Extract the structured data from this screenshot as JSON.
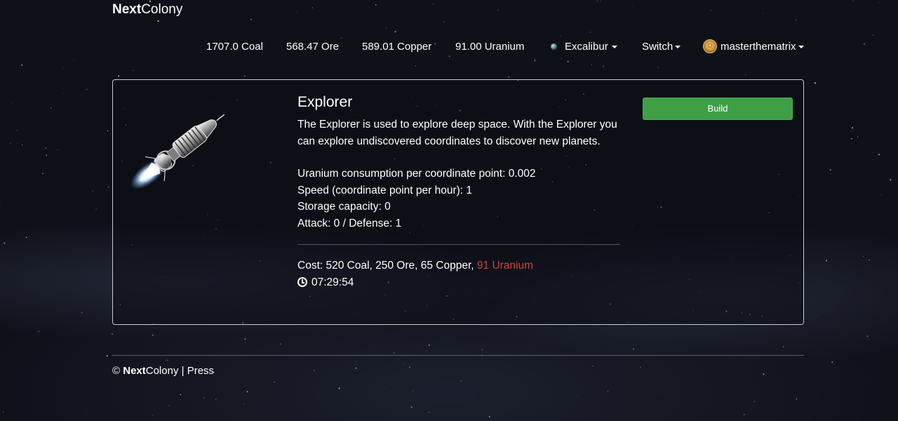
{
  "brand": {
    "bold": "Next",
    "regular": "Colony"
  },
  "resources": {
    "coal": "1707.0 Coal",
    "ore": "568.47 Ore",
    "copper": "589.01 Copper",
    "uranium": "91.00 Uranium"
  },
  "nav": {
    "planet": "Excalibur",
    "switch": "Switch",
    "user": "masterthematrix"
  },
  "ship": {
    "name": "Explorer",
    "description": "The Explorer is used to explore deep space. With the Explorer you can explore undiscovered coordinates to discover new planets.",
    "stats": [
      "Uranium consumption per coordinate point: 0.002",
      "Speed (coordinate point per hour): 1",
      "Storage capacity: 0",
      "Attack: 0 / Defense: 1"
    ],
    "cost_prefix": "Cost: 520 Coal, 250 Ore, 65 Copper, ",
    "cost_short": "91 Uranium",
    "build_time": "07:29:54",
    "build_label": "Build"
  },
  "footer": {
    "copyright": "©",
    "brand_bold": "Next",
    "brand_regular": "Colony",
    "separator": "|",
    "press": "Press"
  },
  "colors": {
    "background": "#0f1119",
    "build_button": "#3f9f45",
    "insufficient_resource": "#c9463f"
  },
  "icons": [
    "planet-icon",
    "user-avatar-icon",
    "clock-icon",
    "caret-down-icon",
    "explorer-ship-image"
  ]
}
